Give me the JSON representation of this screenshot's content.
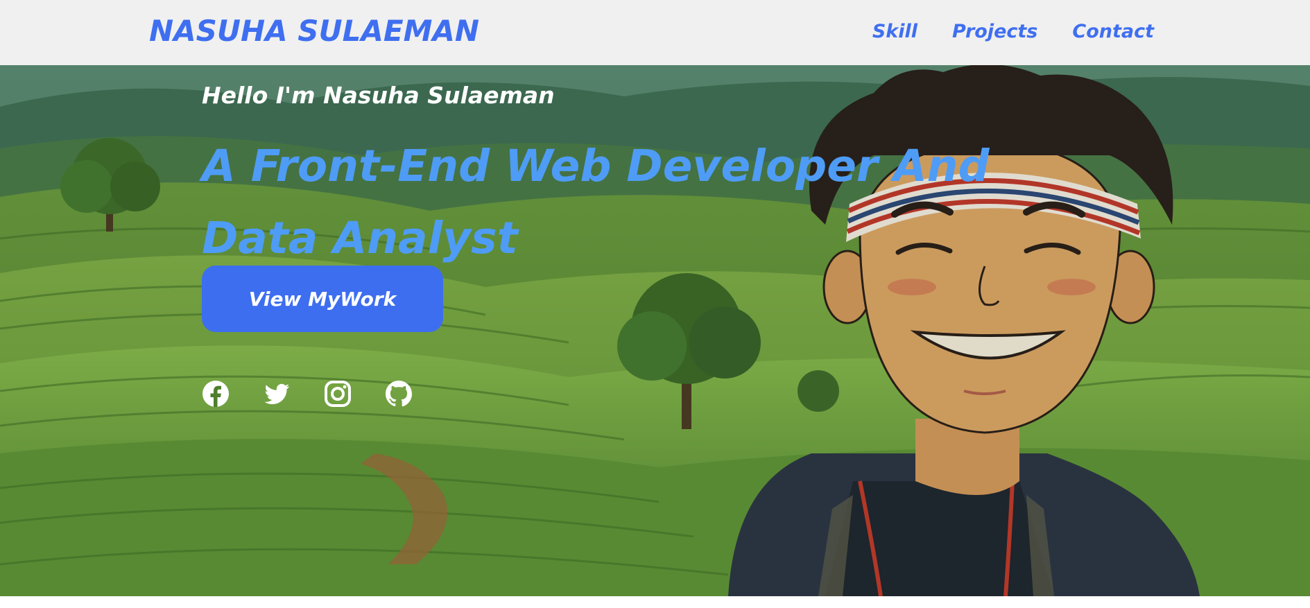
{
  "navbar": {
    "brand": "NASUHA SULAEMAN",
    "links": [
      {
        "label": "Skill"
      },
      {
        "label": "Projects"
      },
      {
        "label": "Contact"
      }
    ]
  },
  "hero": {
    "greeting": "Hello I'm Nasuha Sulaeman",
    "headline": "A Front-End Web Developer And Data Analyst",
    "cta_label": "View MyWork",
    "socials": [
      {
        "icon": "facebook-icon"
      },
      {
        "icon": "twitter-icon"
      },
      {
        "icon": "instagram-icon"
      },
      {
        "icon": "github-icon"
      }
    ],
    "background": "illustration of a smiling boy with a striped headband in front of green tea-plantation hills"
  },
  "colors": {
    "brand": "#3f6ff0",
    "headline": "#4e9cf6",
    "button": "#3d6ef0",
    "navbar_bg": "#f0f0f0"
  }
}
